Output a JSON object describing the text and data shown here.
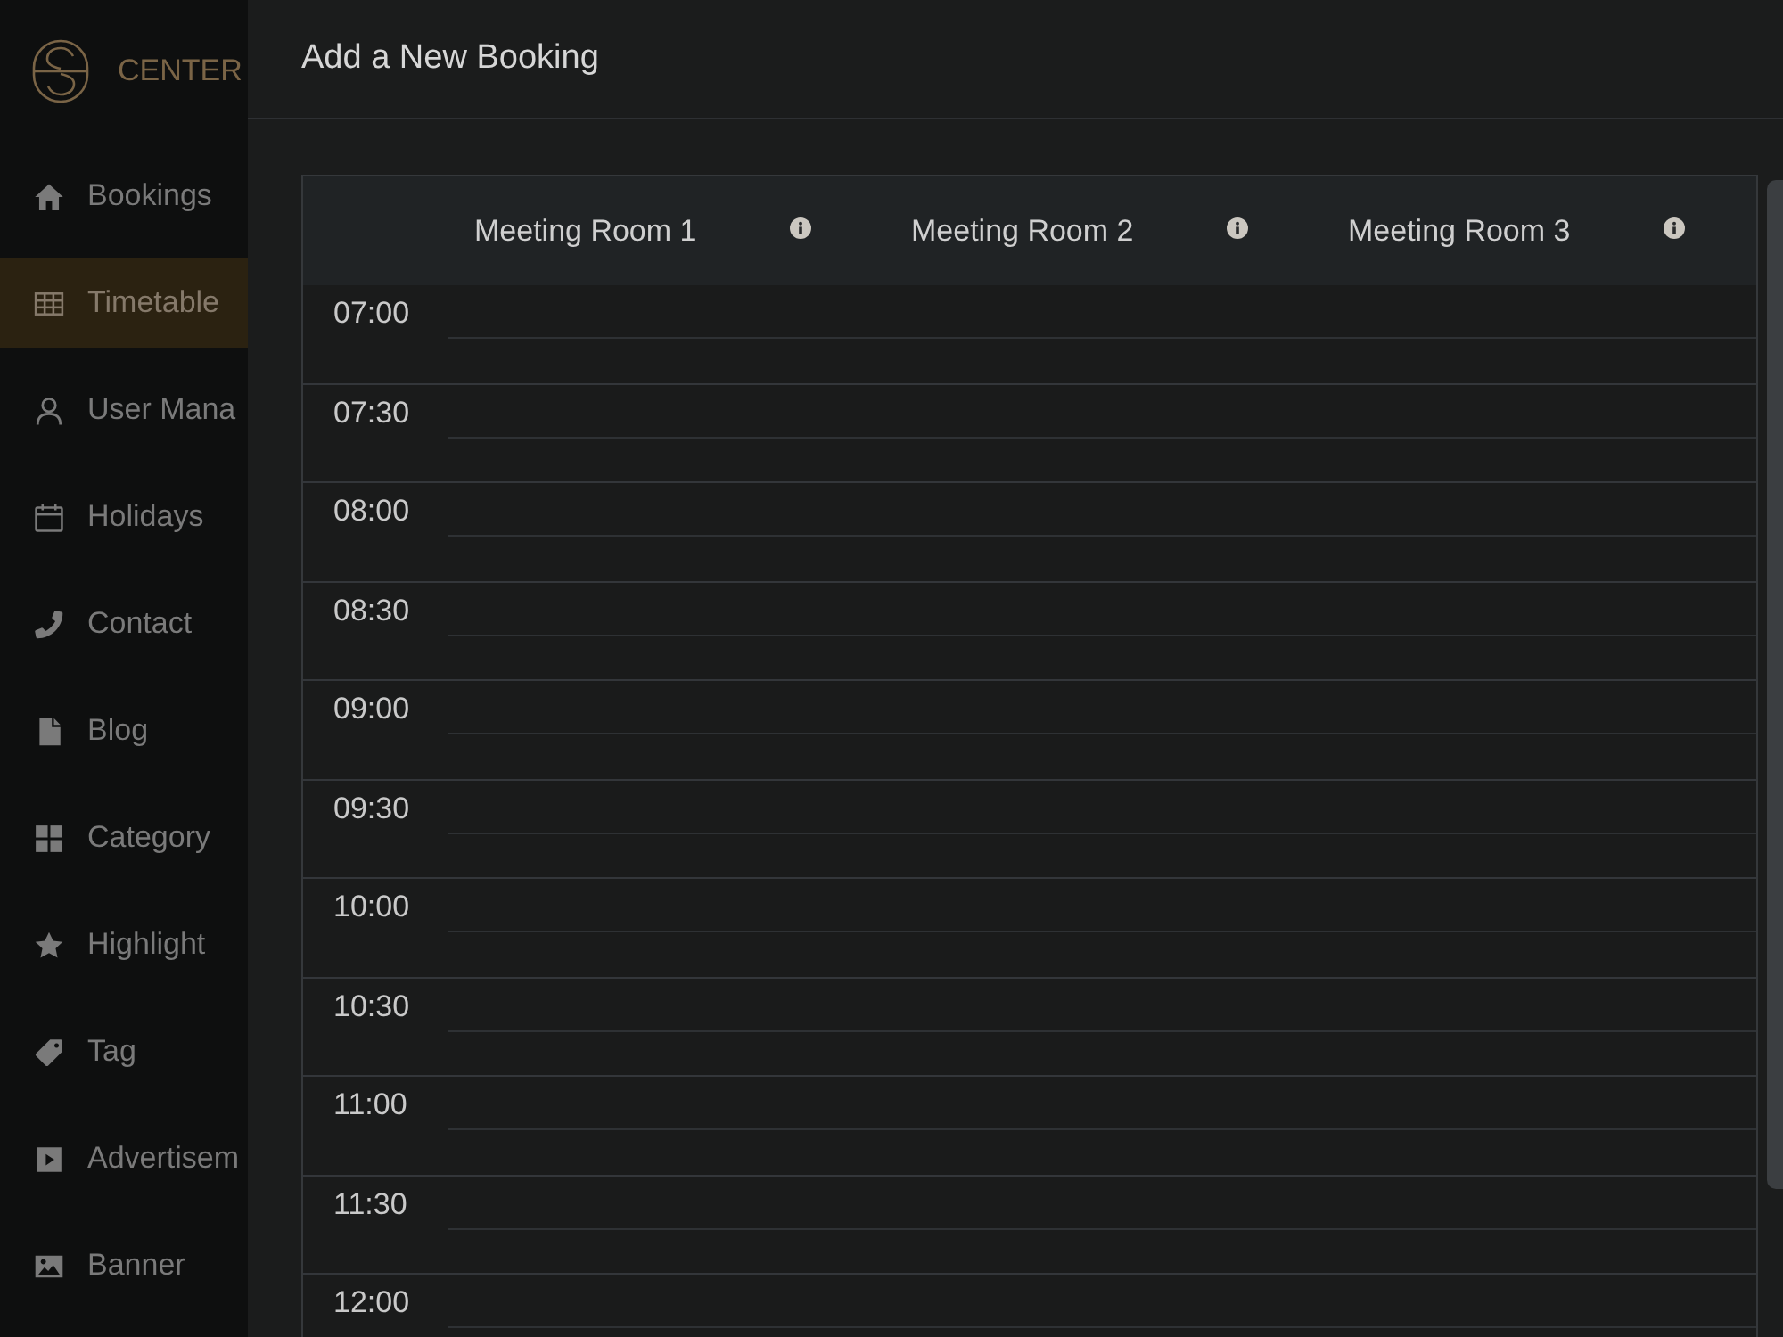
{
  "sidebar": {
    "logo": {
      "text": "CENTER"
    },
    "items": [
      {
        "label": "Bookings",
        "selected": false
      },
      {
        "label": "Timetable",
        "selected": true
      },
      {
        "label": "User Mana",
        "selected": false
      },
      {
        "label": "Holidays",
        "selected": false
      },
      {
        "label": "Contact",
        "selected": false
      },
      {
        "label": "Blog",
        "selected": false
      },
      {
        "label": "Category",
        "selected": false
      },
      {
        "label": "Highlight",
        "selected": false
      },
      {
        "label": "Tag",
        "selected": false
      },
      {
        "label": "Advertisem",
        "selected": false
      },
      {
        "label": "Banner",
        "selected": false
      }
    ]
  },
  "panel": {
    "title": "Add a New Booking"
  },
  "timetable": {
    "columns": [
      {
        "label": "Meeting Room 1"
      },
      {
        "label": "Meeting Room 2"
      },
      {
        "label": "Meeting Room 3"
      }
    ],
    "rows": [
      {
        "time": "07:00"
      },
      {
        "time": "07:30"
      },
      {
        "time": "08:00"
      },
      {
        "time": "08:30"
      },
      {
        "time": "09:00"
      },
      {
        "time": "09:30"
      },
      {
        "time": "10:00"
      },
      {
        "time": "10:30"
      },
      {
        "time": "11:00"
      },
      {
        "time": "11:30"
      },
      {
        "time": "12:00"
      }
    ]
  }
}
